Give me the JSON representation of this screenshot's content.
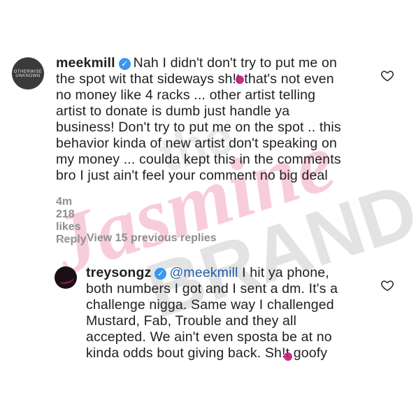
{
  "comments": [
    {
      "username": "meekmill",
      "text": "Nah I didn't don't try to put me on the spot wit that sideways sh!t that's not even no money like 4 racks ... other artist telling artist to donate is dumb just handle ya business! Don't try to put me on the spot .. this behavior kinda of new artist don't speaking on my money ... coulda kept this in the comments bro I just ain't feel your comment no big deal",
      "lines": [
        "Nah I didn't don't try to put me on",
        "the spot wit that sideways sh!t that's not even",
        "no money like 4 racks ... other artist telling",
        "artist to donate is dumb just handle ya",
        "business! Don't try to put me on the spot .. this",
        "behavior kinda of new artist don't  speaking on",
        "my money ... coulda kept this in the comments",
        "bro I just ain't feel your comment no big deal"
      ],
      "time": "4m",
      "likes": "218 likes",
      "reply": "Reply",
      "avatar_text": "OTHERWISE UNKNOWN"
    },
    {
      "username": "treysongz",
      "mention": "@meekmill",
      "lines": [
        "I hit ya phone,",
        "both numbers I got and I sent a dm. It's a",
        "challenge nigga. Same way I challenged",
        "Mustard, Fab, Trouble and they all",
        "accepted. We ain't even sposta be at no",
        "kinda odds bout giving back. Sh!t goofy"
      ]
    }
  ],
  "view_replies": "View 15 previous replies",
  "watermark": {
    "line1": "the",
    "line2": "Jasmine",
    "line3": "BRAND"
  },
  "colors": {
    "verified": "#3897f0",
    "meta": "#8e8e8e",
    "watermark_pink": "#f4a6bd",
    "watermark_gray": "#cfcfcf"
  },
  "icons": [
    "verified-badge-icon",
    "heart-icon"
  ]
}
